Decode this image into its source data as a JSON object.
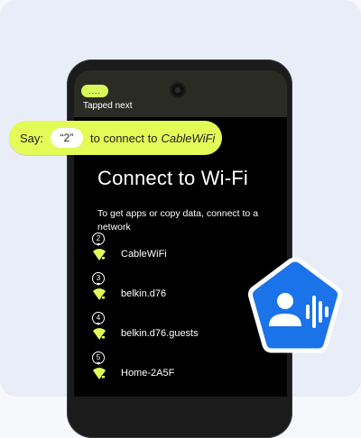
{
  "status": {
    "pill": "....",
    "tapped_text": "Tapped next"
  },
  "prompt": {
    "say_label": "Say:",
    "say_value": "“2”",
    "middle_text": "to connect to",
    "network_name": "CableWiFi"
  },
  "screen": {
    "title": "Connect to Wi-Fi",
    "subtitle": "To get apps or copy data, connect to a network"
  },
  "networks": [
    {
      "badge": "2",
      "name": "CableWiFi"
    },
    {
      "badge": "3",
      "name": "belkin.d76"
    },
    {
      "badge": "4",
      "name": "belkin.d76.guests"
    },
    {
      "badge": "5",
      "name": "Home-2A5F"
    }
  ],
  "icons": {
    "wifi": "wifi-locked-icon",
    "voice_access": "voice-access-icon"
  },
  "colors": {
    "accent": "#e2fb57",
    "wifi_icon": "#e2fb57",
    "logo_blue": "#1a73e8"
  }
}
